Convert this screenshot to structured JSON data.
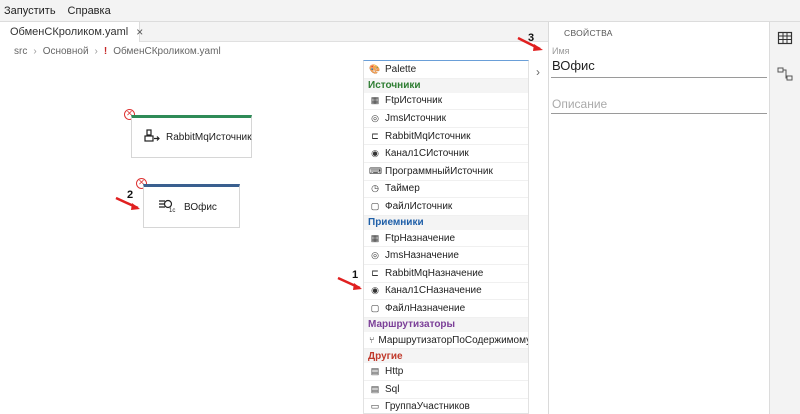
{
  "menu": {
    "run": "Запустить",
    "help": "Справка"
  },
  "tab": {
    "label": "ОбменСКроликом.yaml",
    "close": "×"
  },
  "breadcrumb": {
    "item1": "src",
    "item2": "Основной",
    "excl": "!",
    "item3": "ОбменСКроликом.yaml"
  },
  "nodes": {
    "rabbit": {
      "label": "RabbitMqИсточник",
      "accent": "#2e8b57"
    },
    "office": {
      "label": "ВОфис",
      "accent": "#3a5f8f"
    }
  },
  "annotations": {
    "n1": "1",
    "n2": "2",
    "n3": "3"
  },
  "palette": {
    "header": "Palette",
    "cat_sources": "Источники",
    "cat_dest": "Приемники",
    "cat_routers": "Маршрутизаторы",
    "cat_other": "Другие",
    "sources": [
      "FtpИсточник",
      "JmsИсточник",
      "RabbitMqИсточник",
      "Канал1СИсточник",
      "ПрограммныйИсточник",
      "Таймер",
      "ФайлИсточник"
    ],
    "dest": [
      "FtpНазначение",
      "JmsНазначение",
      "RabbitMqНазначение",
      "Канал1СНазначение",
      "ФайлНазначение"
    ],
    "routers": [
      "МаршрутизаторПоСодержимому"
    ],
    "other": [
      "Http",
      "Sql",
      "ГруппаУчастников"
    ],
    "colors": {
      "sources": "#2e7d32",
      "dest": "#1f5fa8",
      "routers": "#7b3f98",
      "other": "#c0392b"
    }
  },
  "props": {
    "title": "СВОЙСТВА",
    "name_label": "Имя",
    "name_value": "ВОфис",
    "desc_placeholder": "Описание"
  }
}
